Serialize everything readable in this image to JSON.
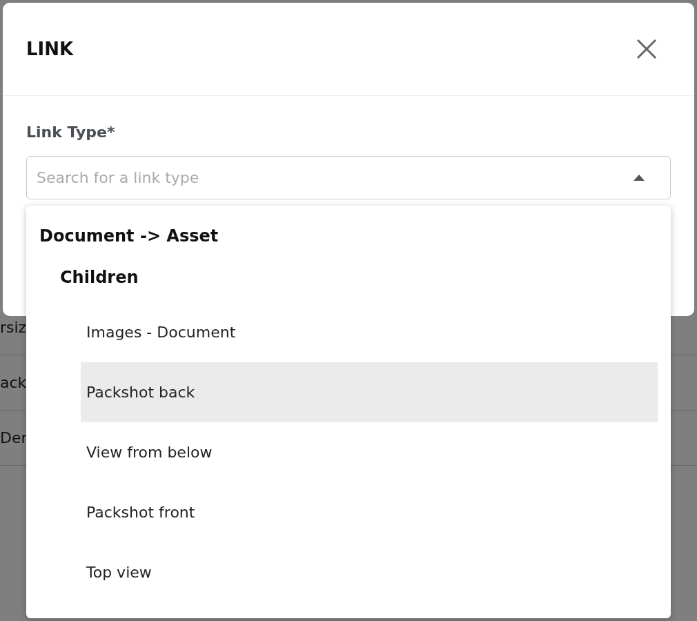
{
  "background": {
    "rows": [
      "rsiz",
      "ack",
      "Der"
    ]
  },
  "dialog": {
    "title": "LINK"
  },
  "field": {
    "label": "Link Type*",
    "placeholder": "Search for a link type",
    "expanded": true
  },
  "dropdown": {
    "groups": [
      {
        "label": "Document -> Asset",
        "children": [
          {
            "label": "Children",
            "options": [
              {
                "label": "Images - Document",
                "selected": false
              },
              {
                "label": "Packshot back",
                "selected": true
              },
              {
                "label": "View from below",
                "selected": false
              },
              {
                "label": "Packshot front",
                "selected": false
              },
              {
                "label": "Top view",
                "selected": false
              }
            ]
          }
        ]
      }
    ]
  }
}
